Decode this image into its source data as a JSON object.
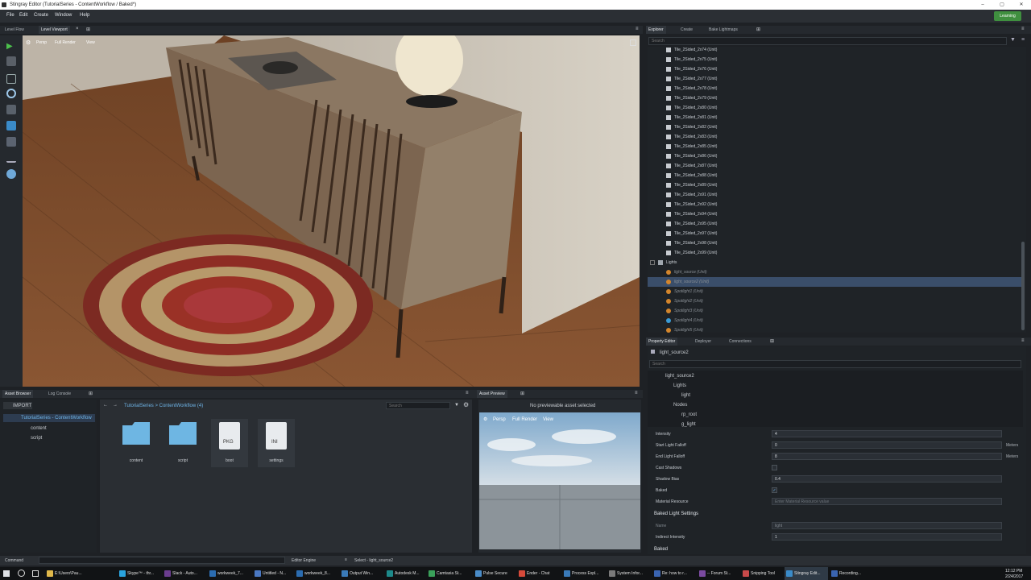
{
  "window": {
    "title": "Stingray Editor (TutorialSeries - ContentWorkflow / Baked*)",
    "minimize": "–",
    "maximize": "▢",
    "close": "✕"
  },
  "menu": [
    "File",
    "Edit",
    "Create",
    "Window",
    "Help"
  ],
  "learning_label": "Learning",
  "left_tabs": {
    "level_flow": "Level Flow",
    "level_viewport": "Level Viewport"
  },
  "viewport_toolbar": {
    "persp": "Persp",
    "full_render": "Full Render",
    "view": "View"
  },
  "explorer": {
    "tabs": [
      "Explorer",
      "Create",
      "Bake Lightmaps"
    ],
    "search_placeholder": "Search",
    "tiles": [
      "Tile_2Sided_2x74 (Unit)",
      "Tile_2Sided_2x75 (Unit)",
      "Tile_2Sided_2x76 (Unit)",
      "Tile_2Sided_2x77 (Unit)",
      "Tile_2Sided_2x78 (Unit)",
      "Tile_2Sided_2x79 (Unit)",
      "Tile_2Sided_2x80 (Unit)",
      "Tile_2Sided_2x81 (Unit)",
      "Tile_2Sided_2x82 (Unit)",
      "Tile_2Sided_2x83 (Unit)",
      "Tile_2Sided_2x85 (Unit)",
      "Tile_2Sided_2x86 (Unit)",
      "Tile_2Sided_2x87 (Unit)",
      "Tile_2Sided_2x88 (Unit)",
      "Tile_2Sided_2x89 (Unit)",
      "Tile_2Sided_2x91 (Unit)",
      "Tile_2Sided_2x92 (Unit)",
      "Tile_2Sided_2x94 (Unit)",
      "Tile_2Sided_2x95 (Unit)",
      "Tile_2Sided_2x97 (Unit)",
      "Tile_2Sided_2x98 (Unit)",
      "Tile_2Sided_2x99 (Unit)"
    ],
    "lights_group": "Lights",
    "lights": [
      "light_source (Unit)",
      "light_source2 (Unit)",
      "Spotlight1 (Unit)",
      "Spotlight2 (Unit)",
      "Spotlight3 (Unit)",
      "Spotlight4 (Unit)",
      "Spotlight5 (Unit)"
    ]
  },
  "property_editor": {
    "tabs": [
      "Property Editor",
      "Deployer",
      "Connections"
    ],
    "selected_name": "light_source2",
    "search_placeholder": "Search",
    "tree": [
      "light_source2",
      "Lights",
      "light",
      "Nodes",
      "rp_root",
      "g_light"
    ],
    "props": [
      {
        "label": "Intensity",
        "value": "4",
        "unit": ""
      },
      {
        "label": "Start Light Falloff",
        "value": "0",
        "unit": "Meters"
      },
      {
        "label": "End Light Falloff",
        "value": "8",
        "unit": "Meters"
      },
      {
        "label": "Cast Shadows",
        "value": "",
        "unit": ""
      },
      {
        "label": "Shadow Bias",
        "value": "0.4",
        "unit": ""
      },
      {
        "label": "Baked",
        "value": "✓",
        "unit": ""
      },
      {
        "label": "Material Resource",
        "value": "Enter Material Resource value",
        "unit": ""
      }
    ],
    "baked_section": "Baked Light Settings",
    "baked_props": [
      {
        "label": "Name",
        "value": "light"
      },
      {
        "label": "Indirect Intensity",
        "value": "1"
      }
    ],
    "bottom_section": "Baked"
  },
  "asset_browser": {
    "tabs": [
      "Asset Browser",
      "Log Console"
    ],
    "import_label": "IMPORT",
    "root": "TutorialSeries - ContentWorkflow",
    "folders": [
      "content",
      "script"
    ],
    "breadcrumb": "TutorialSeries > ContentWorkflow (4)",
    "search_placeholder": "Search",
    "items": [
      {
        "name": "content",
        "kind": "folder"
      },
      {
        "name": "script",
        "kind": "folder"
      },
      {
        "name": "boot",
        "kind": "PKG"
      },
      {
        "name": "settings",
        "kind": "INI"
      }
    ]
  },
  "asset_preview": {
    "tab": "Asset Preview",
    "status": "No previewable asset selected",
    "persp": "Persp",
    "full_render": "Full Render",
    "view": "View"
  },
  "statusbar": {
    "command_label": "Command",
    "engine_label": "Editor Engine",
    "status_text": "Select - light_source2"
  },
  "taskbar": {
    "items": [
      "E:\\Users\\Pau...",
      "Skype™ - thr...",
      "Slack - Auto...",
      "workweek_7...",
      "Untitled - N...",
      "workweek_8...",
      "Output Win...",
      "Autodesk M...",
      "Camtasia St...",
      "Pulse Secure",
      "Ender - Chat",
      "Process Expl...",
      "System Infor...",
      "Re: how to r...",
      "-- Forum St...",
      "Snipping Tool",
      "Stingray Edit...",
      "Recording..."
    ],
    "time": "12:12 PM",
    "date": "2/24/2017"
  },
  "colors": {
    "accent": "#3a9bd6",
    "selection": "#3a4e6a",
    "learning": "#3f8f3f"
  }
}
